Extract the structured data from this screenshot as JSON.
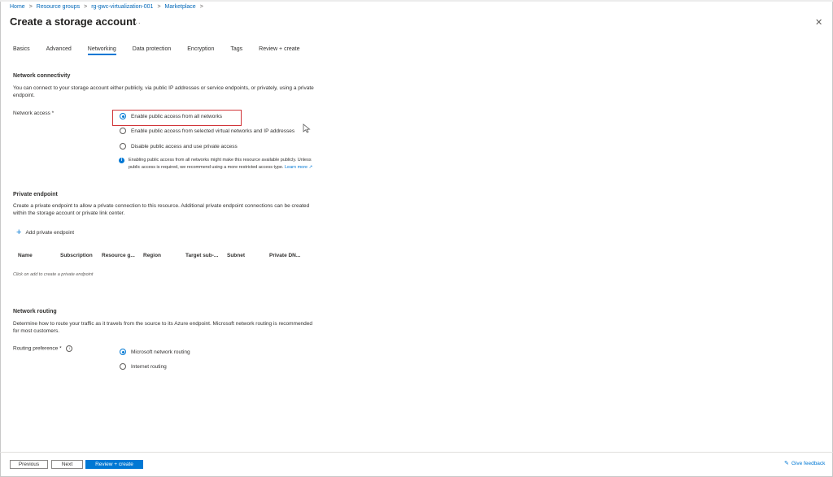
{
  "breadcrumb": [
    "Home",
    "Resource groups",
    "rg-gwc-virtualization-001",
    "Marketplace"
  ],
  "title": "Create a storage account",
  "more_icon": "...",
  "close_icon": "✕",
  "tabs": [
    "Basics",
    "Advanced",
    "Networking",
    "Data protection",
    "Encryption",
    "Tags",
    "Review + create"
  ],
  "active_tab": "Networking",
  "network_connectivity": {
    "heading": "Network connectivity",
    "description": "You can connect to your storage account either publicly, via public IP addresses or service endpoints, or privately, using a private endpoint.",
    "label": "Network access *",
    "options": [
      "Enable public access from all networks",
      "Enable public access from selected virtual networks and IP addresses",
      "Disable public access and use private access"
    ],
    "selected_index": 0,
    "info_text": "Enabling public access from all networks might make this resource available publicly. Unless public access is required, we recommend using a more restricted access type.",
    "info_link": "Learn more ↗"
  },
  "private_endpoint": {
    "heading": "Private endpoint",
    "description": "Create a private endpoint to allow a private connection to this resource. Additional private endpoint connections can be created within the storage account or private link center.",
    "add_label": "Add private endpoint",
    "columns": [
      "Name",
      "Subscription",
      "Resource g...",
      "Region",
      "Target sub-...",
      "Subnet",
      "Private DN..."
    ],
    "empty_text": "Click on add to create a private endpoint"
  },
  "network_routing": {
    "heading": "Network routing",
    "description": "Determine how to route your traffic as it travels from the source to its Azure endpoint. Microsoft network routing is recommended for most customers.",
    "label": "Routing preference *",
    "options": [
      "Microsoft network routing",
      "Internet routing"
    ],
    "selected_index": 0
  },
  "footer": {
    "previous": "Previous",
    "next": "Next",
    "review_create": "Review + create",
    "feedback": "Give feedback"
  },
  "colors": {
    "accent": "#0078d4",
    "highlight": "#d13438"
  }
}
